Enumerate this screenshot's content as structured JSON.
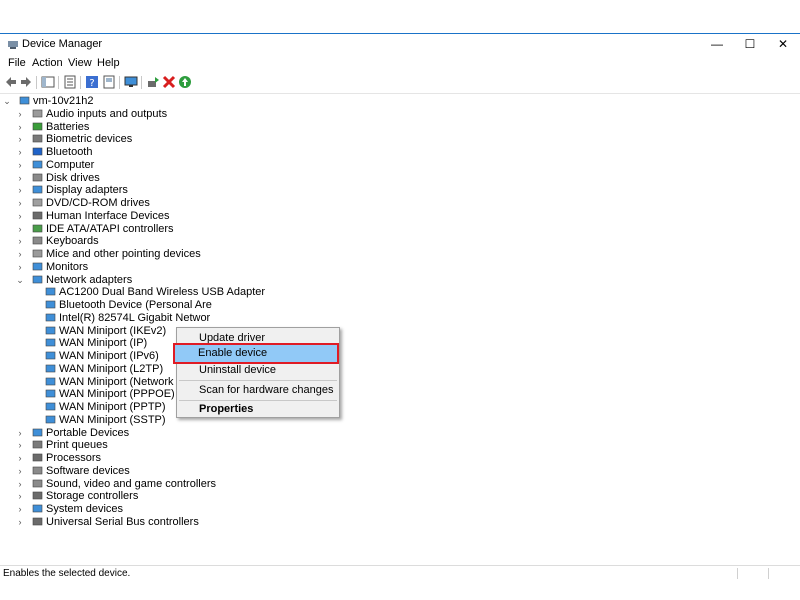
{
  "window": {
    "title": "Device Manager",
    "minimize": "—",
    "maximize": "☐",
    "close": "✕"
  },
  "menu": [
    "File",
    "Action",
    "View",
    "Help"
  ],
  "toolbar_icons": [
    "back-arrow-icon",
    "forward-arrow-icon",
    "show-hide-tree-icon",
    "properties-icon",
    "help-icon",
    "show-hidden-icon",
    "monitor-icon",
    "update-driver-icon",
    "uninstall-icon",
    "enable-device-icon"
  ],
  "tree": {
    "root": "vm-10v21h2",
    "categories": [
      {
        "label": "Audio inputs and outputs",
        "icon": "speaker-icon"
      },
      {
        "label": "Batteries",
        "icon": "battery-icon"
      },
      {
        "label": "Biometric devices",
        "icon": "fingerprint-icon"
      },
      {
        "label": "Bluetooth",
        "icon": "bluetooth-icon"
      },
      {
        "label": "Computer",
        "icon": "computer-icon"
      },
      {
        "label": "Disk drives",
        "icon": "disk-icon"
      },
      {
        "label": "Display adapters",
        "icon": "display-icon"
      },
      {
        "label": "DVD/CD-ROM drives",
        "icon": "dvd-icon"
      },
      {
        "label": "Human Interface Devices",
        "icon": "hid-icon"
      },
      {
        "label": "IDE ATA/ATAPI controllers",
        "icon": "ide-icon"
      },
      {
        "label": "Keyboards",
        "icon": "keyboard-icon"
      },
      {
        "label": "Mice and other pointing devices",
        "icon": "mouse-icon"
      },
      {
        "label": "Monitors",
        "icon": "monitor-icon"
      },
      {
        "label": "Network adapters",
        "icon": "network-icon"
      }
    ],
    "network_children": [
      "AC1200  Dual Band Wireless USB Adapter",
      "Bluetooth Device (Personal Are",
      "Intel(R) 82574L Gigabit Networ",
      "WAN Miniport (IKEv2)",
      "WAN Miniport (IP)",
      "WAN Miniport (IPv6)",
      "WAN Miniport (L2TP)",
      "WAN Miniport (Network Monit",
      "WAN Miniport (PPPOE)",
      "WAN Miniport (PPTP)",
      "WAN Miniport (SSTP)"
    ],
    "categories_after": [
      {
        "label": "Portable Devices",
        "icon": "portable-icon"
      },
      {
        "label": "Print queues",
        "icon": "printer-icon"
      },
      {
        "label": "Processors",
        "icon": "processor-icon"
      },
      {
        "label": "Software devices",
        "icon": "software-icon"
      },
      {
        "label": "Sound, video and game controllers",
        "icon": "sound-icon"
      },
      {
        "label": "Storage controllers",
        "icon": "storage-icon"
      },
      {
        "label": "System devices",
        "icon": "system-icon"
      },
      {
        "label": "Universal Serial Bus controllers",
        "icon": "usb-icon"
      }
    ]
  },
  "context_menu": {
    "update_driver": "Update driver",
    "enable_device": "Enable device",
    "uninstall_device": "Uninstall device",
    "scan": "Scan for hardware changes",
    "properties": "Properties"
  },
  "status": {
    "text": "Enables the selected device."
  },
  "colors": {
    "highlight": "#91c9f7",
    "outline": "#e01b24",
    "selection": "#cce4f7"
  }
}
